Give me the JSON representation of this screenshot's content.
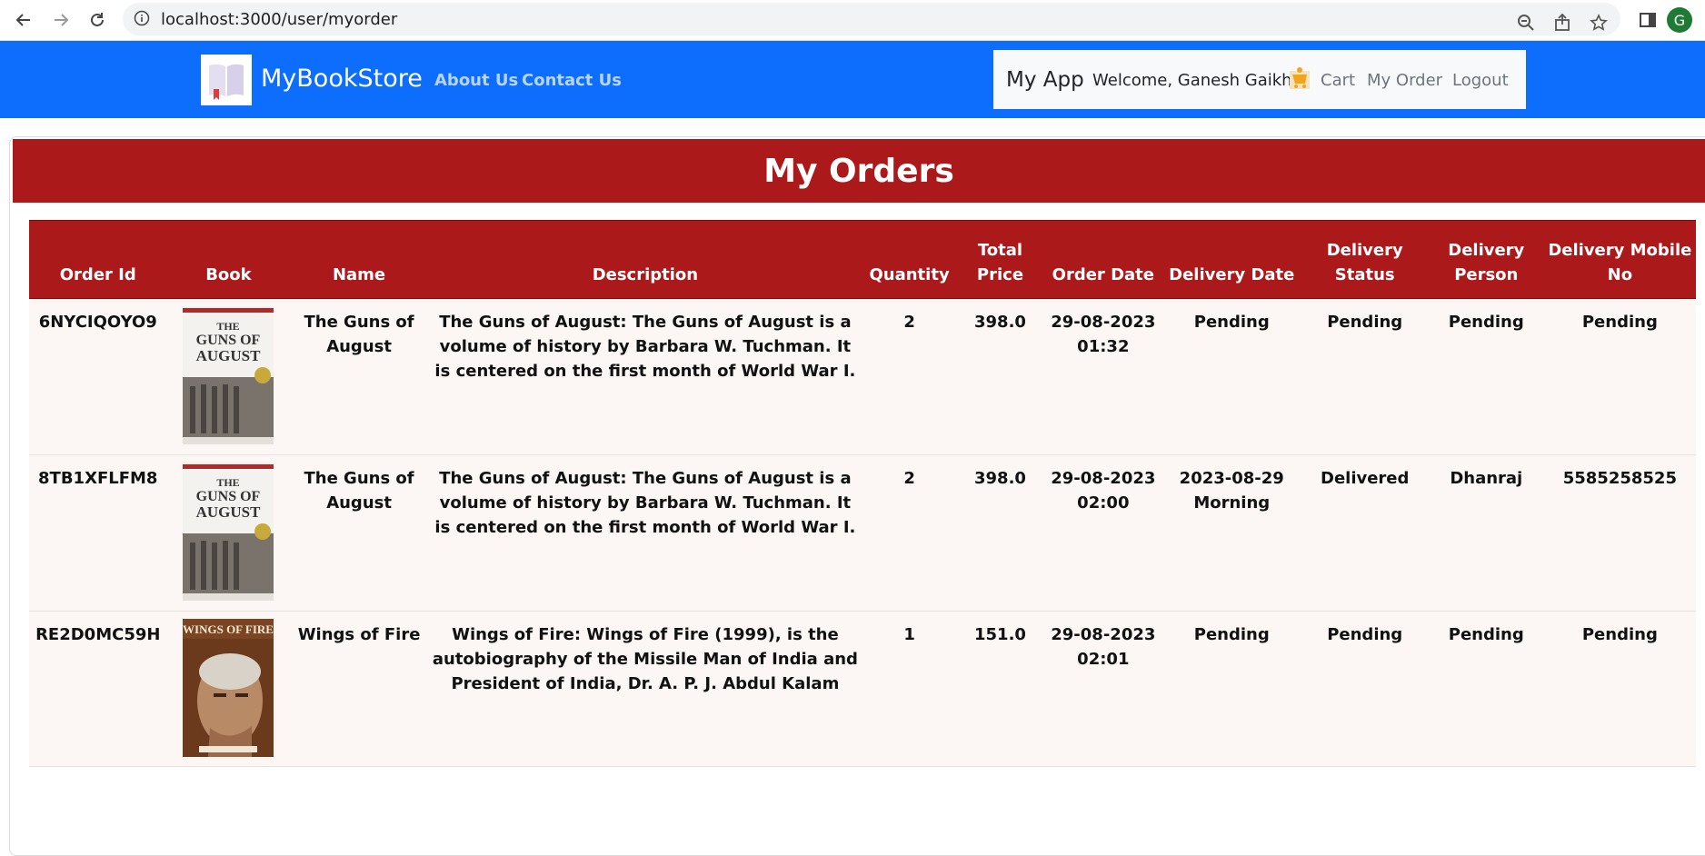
{
  "browser": {
    "url": "localhost:3000/user/myorder",
    "profile_initial": "G"
  },
  "navbar": {
    "brand": "MyBookStore",
    "links": [
      "About Us",
      "Contact Us"
    ],
    "app_title": "My App",
    "welcome": "Welcome, Ganesh Gaikhe",
    "cart": "Cart",
    "my_order": "My Order",
    "logout": "Logout",
    "colors": {
      "primary": "#0d6efd",
      "accent": "#ab191b"
    }
  },
  "page": {
    "title": "My Orders"
  },
  "table": {
    "headers": [
      "Order Id",
      "Book",
      "Name",
      "Description",
      "Quantity",
      "Total Price",
      "Order Date",
      "Delivery Date",
      "Delivery Status",
      "Delivery Person",
      "Delivery Mobile No"
    ],
    "rows": [
      {
        "order_id": "6NYCIQOYO9",
        "book_cover": "guns-of-august-cover",
        "name": "The Guns of August",
        "description": "The Guns of August: The Guns of August is a volume of history by Barbara W. Tuchman. It is centered on the first month of World War I.",
        "quantity": "2",
        "total_price": "398.0",
        "order_date": "29-08-2023 01:32",
        "delivery_date": "Pending",
        "delivery_status": "Pending",
        "delivery_person": "Pending",
        "delivery_mobile": "Pending"
      },
      {
        "order_id": "8TB1XFLFM8",
        "book_cover": "guns-of-august-cover",
        "name": "The Guns of August",
        "description": "The Guns of August: The Guns of August is a volume of history by Barbara W. Tuchman. It is centered on the first month of World War I.",
        "quantity": "2",
        "total_price": "398.0",
        "order_date": "29-08-2023 02:00",
        "delivery_date": "2023-08-29 Morning",
        "delivery_status": "Delivered",
        "delivery_person": "Dhanraj",
        "delivery_mobile": "5585258525"
      },
      {
        "order_id": "RE2D0MC59H",
        "book_cover": "wings-of-fire-cover",
        "name": "Wings of Fire",
        "description": "Wings of Fire: Wings of Fire (1999), is the autobiography of the Missile Man of India and President of India, Dr. A. P. J. Abdul Kalam",
        "quantity": "1",
        "total_price": "151.0",
        "order_date": "29-08-2023 02:01",
        "delivery_date": "Pending",
        "delivery_status": "Pending",
        "delivery_person": "Pending",
        "delivery_mobile": "Pending"
      }
    ]
  }
}
